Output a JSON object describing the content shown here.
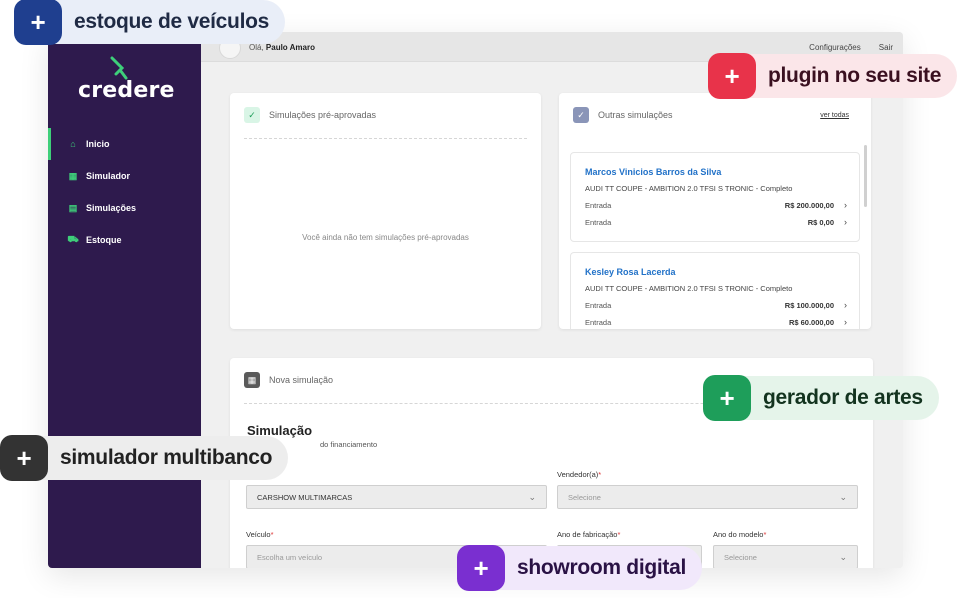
{
  "sidebar": {
    "logo": "credere",
    "items": [
      {
        "label": "Inicio",
        "icon": "home-icon"
      },
      {
        "label": "Simulador",
        "icon": "calculator-icon"
      },
      {
        "label": "Simulações",
        "icon": "list-icon"
      },
      {
        "label": "Estoque",
        "icon": "car-icon"
      }
    ]
  },
  "topbar": {
    "greeting_prefix": "Olá,",
    "user_name": "Paulo Amaro",
    "links": [
      "Configurações",
      "Sair"
    ]
  },
  "preapproved": {
    "title": "Simulações pré-aprovadas",
    "empty_text": "Você ainda não tem simulações pré-aprovadas"
  },
  "others": {
    "title": "Outras simulações",
    "see_all": "ver todas",
    "items": [
      {
        "name": "Marcos Vinicios Barros da Silva",
        "car": "AUDI TT COUPE - AMBITION 2.0 TFSI S TRONIC - Completo",
        "rows": [
          {
            "label": "Entrada",
            "value": "R$ 200.000,00"
          },
          {
            "label": "Entrada",
            "value": "R$ 0,00"
          }
        ]
      },
      {
        "name": "Kesley Rosa Lacerda",
        "car": "AUDI TT COUPE - AMBITION 2.0 TFSI S TRONIC - Completo",
        "rows": [
          {
            "label": "Entrada",
            "value": "R$ 100.000,00"
          },
          {
            "label": "Entrada",
            "value": "R$ 60.000,00"
          }
        ]
      }
    ]
  },
  "new_sim": {
    "header": "Nova simulação",
    "title": "Simulação",
    "subtitle": "do financiamento",
    "store_value": "CARSHOW MULTIMARCAS",
    "seller_label": "Vendedor(a)",
    "seller_placeholder": "Selecione",
    "vehicle_label": "Veículo",
    "vehicle_placeholder": "Escolha um veículo",
    "year_fab_label": "Ano de fabricação",
    "year_model_label": "Ano do modelo",
    "year_model_placeholder": "Selecione",
    "required_mark": "*"
  },
  "badges": {
    "stock": "estoque de veículos",
    "plugin": "plugin no seu site",
    "art": "gerador de artes",
    "simulator": "simulador multibanco",
    "showroom": "showroom digital",
    "plus": "+"
  },
  "colors": {
    "sidebar": "#2e1a4d",
    "accent_green": "#3ecf7a",
    "link_blue": "#2272c8",
    "badge_blue": "#1f3f8f",
    "badge_red": "#e8334a",
    "badge_green": "#1e9e5a",
    "badge_dark": "#333333",
    "badge_purple": "#7a2fd0"
  }
}
